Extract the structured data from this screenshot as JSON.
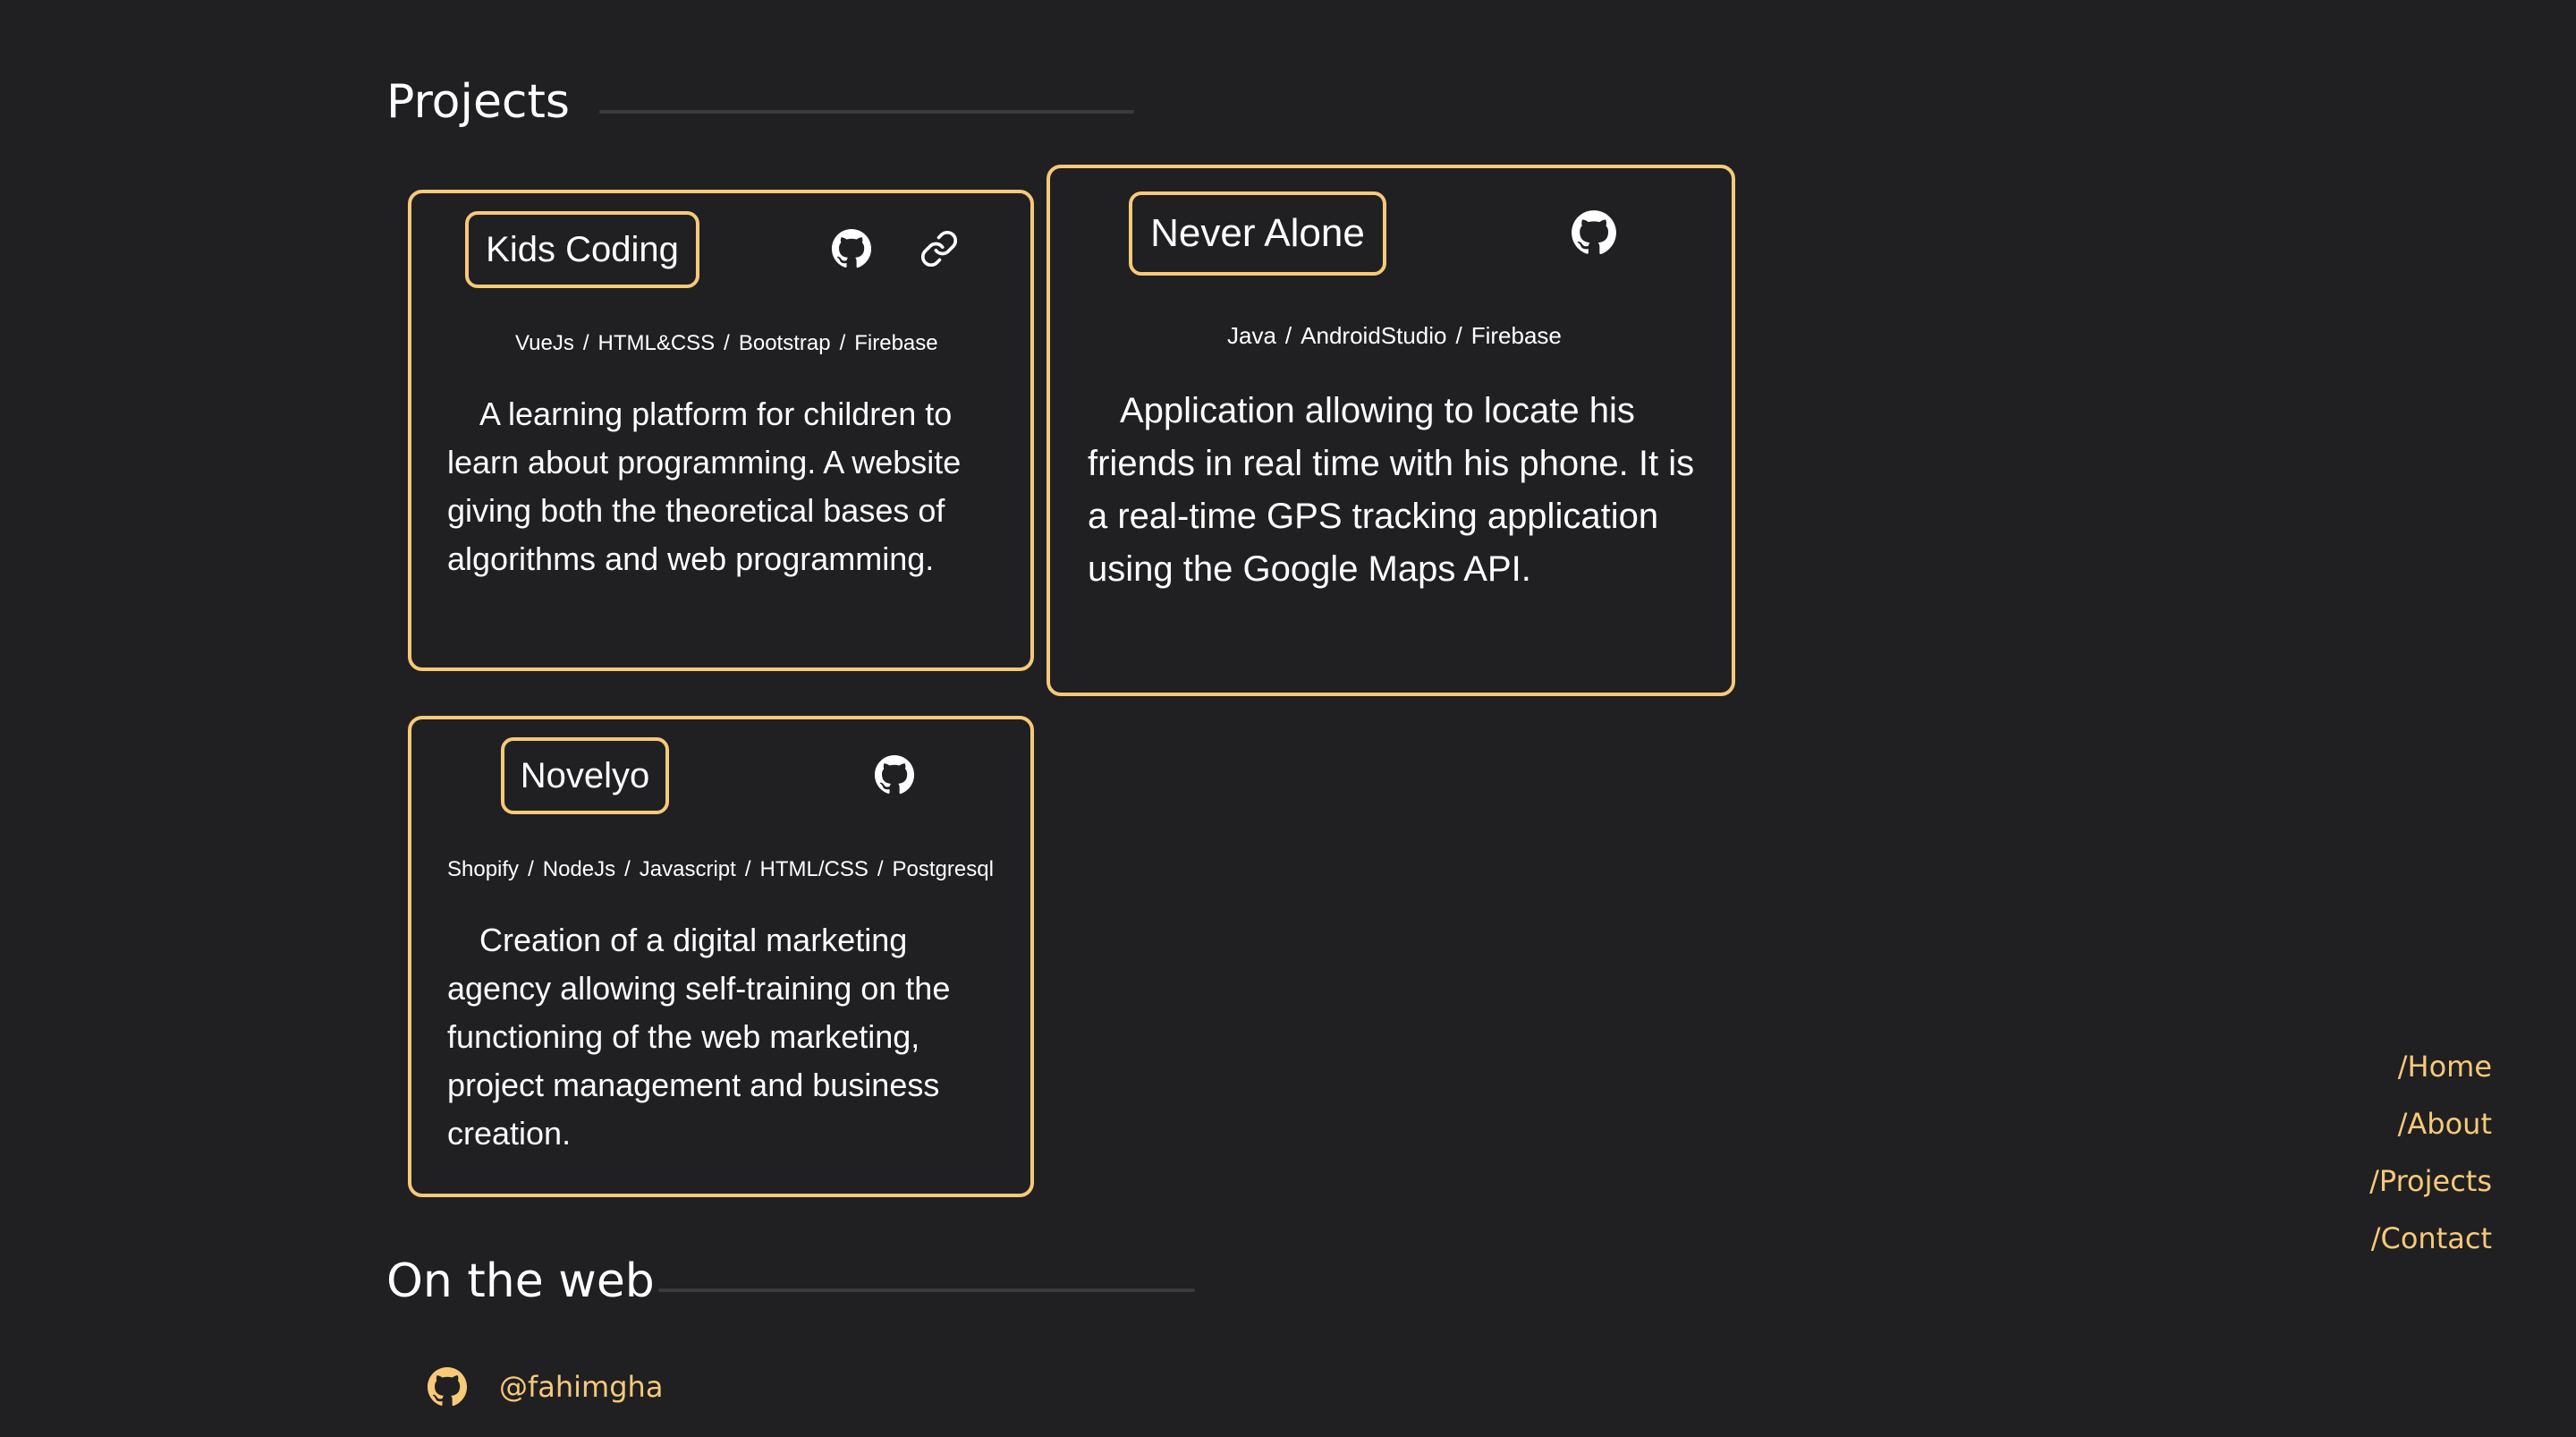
{
  "projects_section": {
    "title": "Projects",
    "cards": [
      {
        "title": "Kids Coding",
        "tech": [
          "VueJs",
          "HTML&CSS",
          "Bootstrap",
          "Firebase"
        ],
        "description": "A learning platform for children to learn about programming. A website giving both the theoretical bases of algorithms and web programming.",
        "icons": [
          "github-icon",
          "link-icon"
        ]
      },
      {
        "title": "Never Alone",
        "tech": [
          "Java",
          "AndroidStudio",
          "Firebase"
        ],
        "description": "Application allowing to locate his friends in real time with his phone. It is a real-time GPS tracking application using the Google Maps API.",
        "icons": [
          "github-icon"
        ]
      },
      {
        "title": "Novelyo",
        "tech": [
          "Shopify",
          "NodeJs",
          "Javascript",
          "HTML/CSS",
          "Postgresql"
        ],
        "description": "Creation of a digital marketing agency allowing self-training on the functioning of the web marketing, project management and business creation.",
        "icons": [
          "github-icon"
        ]
      }
    ],
    "separator": "/"
  },
  "web_section": {
    "title": "On the web",
    "github_handle": "@fahimgha",
    "icon": "github-icon"
  },
  "nav": {
    "home": "/Home",
    "about": "/About",
    "projects": "/Projects",
    "contact": "/Contact"
  },
  "colors": {
    "background": "#202023",
    "accent": "#f7c978",
    "text": "#ffffff"
  }
}
